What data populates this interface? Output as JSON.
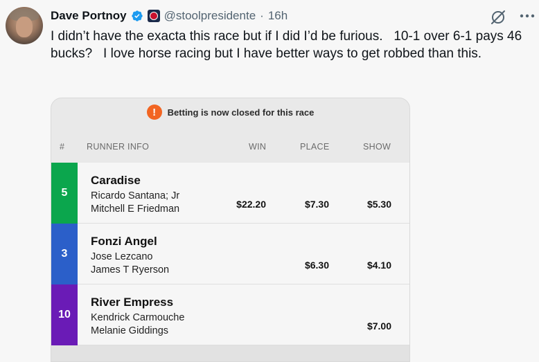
{
  "tweet": {
    "author_name": "Dave Portnoy",
    "handle": "@stoolpresidente",
    "separator": "·",
    "time": "16h",
    "text": "I didn’t have the exacta this race but if I did I’d be furious.   10-1 over 6-1 pays 46 bucks?   I love horse racing but I have better ways to get robbed than this.",
    "icons": [
      "verified-badge-icon",
      "org-badge-icon",
      "grok-icon",
      "more-icon"
    ]
  },
  "card": {
    "alert_text": "Betting is now closed for this race",
    "alert_icon": "!",
    "columns": {
      "num": "#",
      "runner": "RUNNER INFO",
      "win": "WIN",
      "place": "PLACE",
      "show": "SHOW"
    },
    "runners": [
      {
        "number": "5",
        "color": "#0ba64d",
        "horse": "Caradise",
        "jockey": "Ricardo Santana; Jr",
        "trainer": "Mitchell E Friedman",
        "win": "$22.20",
        "place": "$7.30",
        "show": "$5.30"
      },
      {
        "number": "3",
        "color": "#2b5fc9",
        "horse": "Fonzi Angel",
        "jockey": "Jose Lezcano",
        "trainer": "James T Ryerson",
        "win": "",
        "place": "$6.30",
        "show": "$4.10"
      },
      {
        "number": "10",
        "color": "#6a1bb6",
        "horse": "River Empress",
        "jockey": "Kendrick Carmouche",
        "trainer": "Melanie Giddings",
        "win": "",
        "place": "",
        "show": "$7.00"
      }
    ]
  }
}
